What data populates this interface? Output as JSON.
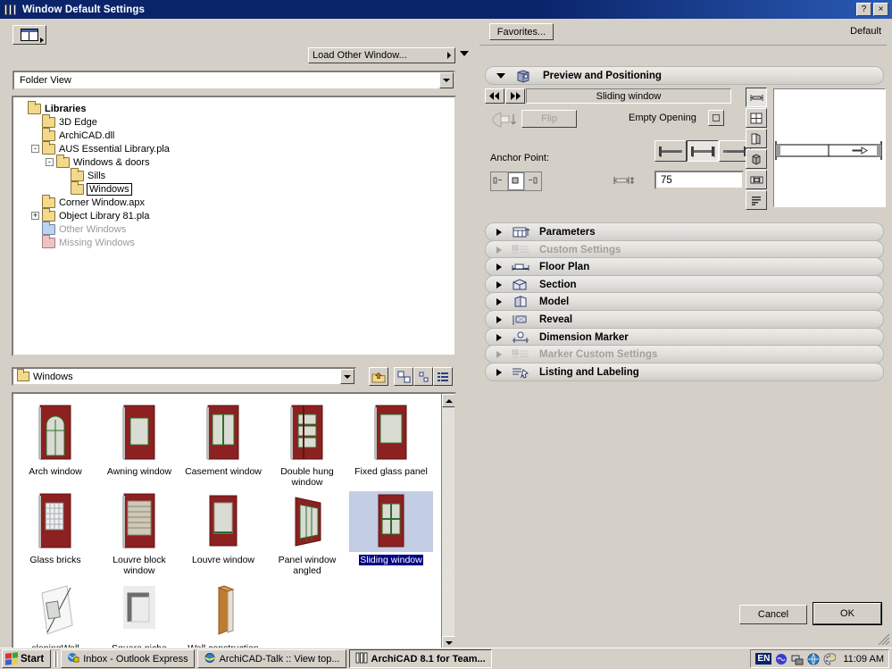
{
  "window": {
    "title": "Window Default Settings",
    "help_button": "?",
    "close_button": "×"
  },
  "left_panel": {
    "view_mode_button_icon": "window-layout-icon",
    "load_other_button": "Load Other Window...",
    "folder_view_combo": "Folder View",
    "tree": [
      {
        "label": "Libraries",
        "depth": 0,
        "bold": true,
        "expander": "",
        "folder": "yellow",
        "dim": false,
        "selected": false
      },
      {
        "label": "3D Edge",
        "depth": 1,
        "bold": false,
        "expander": "",
        "folder": "yellow",
        "dim": false,
        "selected": false
      },
      {
        "label": "ArchiCAD.dll",
        "depth": 1,
        "bold": false,
        "expander": "",
        "folder": "yellow",
        "dim": false,
        "selected": false
      },
      {
        "label": "AUS Essential Library.pla",
        "depth": 1,
        "bold": false,
        "expander": "-",
        "folder": "yellow",
        "dim": false,
        "selected": false
      },
      {
        "label": "Windows & doors",
        "depth": 2,
        "bold": false,
        "expander": "-",
        "folder": "yellow",
        "dim": false,
        "selected": false
      },
      {
        "label": "Sills",
        "depth": 3,
        "bold": false,
        "expander": "",
        "folder": "yellow",
        "dim": false,
        "selected": false
      },
      {
        "label": "Windows",
        "depth": 3,
        "bold": false,
        "expander": "",
        "folder": "yellow",
        "dim": false,
        "selected": true
      },
      {
        "label": "Corner Window.apx",
        "depth": 1,
        "bold": false,
        "expander": "",
        "folder": "yellow",
        "dim": false,
        "selected": false
      },
      {
        "label": "Object Library 81.pla",
        "depth": 1,
        "bold": false,
        "expander": "+",
        "folder": "yellow",
        "dim": false,
        "selected": false
      },
      {
        "label": "Other Windows",
        "depth": 1,
        "bold": false,
        "expander": "",
        "folder": "blue",
        "dim": true,
        "selected": false
      },
      {
        "label": "Missing Windows",
        "depth": 1,
        "bold": false,
        "expander": "",
        "folder": "pink",
        "dim": true,
        "selected": false
      }
    ],
    "folder_combo": "Windows",
    "up_button_icon": "folder-up-icon",
    "view_buttons": [
      "large-icons-view-icon",
      "small-icons-view-icon",
      "list-view-icon"
    ],
    "items": [
      [
        {
          "label": "Arch window",
          "type": "arch",
          "selected": false
        },
        {
          "label": "Awning window",
          "type": "awning",
          "selected": false
        },
        {
          "label": "Casement window",
          "type": "casement",
          "selected": false
        },
        {
          "label": "Double hung window",
          "type": "hung",
          "selected": false
        },
        {
          "label": "Fixed glass panel",
          "type": "fixed",
          "selected": false
        }
      ],
      [
        {
          "label": "Glass bricks",
          "type": "bricks",
          "selected": false
        },
        {
          "label": "Louvre block window",
          "type": "louvreblk",
          "selected": false
        },
        {
          "label": "Louvre window",
          "type": "louvre",
          "selected": false
        },
        {
          "label": "Panel window angled",
          "type": "angled",
          "selected": false
        },
        {
          "label": "Sliding window",
          "type": "sliding",
          "selected": true
        }
      ],
      [
        {
          "label": "slopingWall",
          "type": "sloping",
          "selected": false
        },
        {
          "label": "Square niche",
          "type": "niche",
          "selected": false
        },
        {
          "label": "Wall construction joint",
          "type": "joint",
          "selected": false
        }
      ]
    ]
  },
  "right_panel": {
    "favorites_button": "Favorites...",
    "default_label": "Default",
    "preview_section": {
      "title": "Preview and Positioning",
      "icon": "preview-cube-icon",
      "expanded": true,
      "prev_button_icon": "prev-arrows-icon",
      "next_button_icon": "next-arrows-icon",
      "object_name": "Sliding window",
      "flip_button": "Flip",
      "mirror_icon": "mirror-icon",
      "empty_opening_label": "Empty Opening",
      "empty_opening_checked": false,
      "anchor_point_label": "Anchor Point:",
      "sill_height_value": "75",
      "sill_height_icon": "sill-height-icon",
      "align_buttons": [
        "align-left-icon",
        "align-center-icon",
        "align-right-icon"
      ],
      "align_selected_index": 1,
      "view_tools": [
        "floor-plan-view-icon",
        "front-view-icon",
        "side-view-icon",
        "3d-view-icon",
        "section-view-icon",
        "list-view-icon"
      ],
      "view_tool_selected_index": 0
    },
    "sections": [
      {
        "label": "Parameters",
        "icon": "parameters-icon",
        "disabled": false
      },
      {
        "label": "Custom Settings",
        "icon": "custom-settings-icon",
        "disabled": true
      },
      {
        "label": "Floor Plan",
        "icon": "floor-plan-icon",
        "disabled": false
      },
      {
        "label": "Section",
        "icon": "section-icon",
        "disabled": false
      },
      {
        "label": "Model",
        "icon": "model-icon",
        "disabled": false
      },
      {
        "label": "Reveal",
        "icon": "reveal-icon",
        "disabled": false
      },
      {
        "label": "Dimension Marker",
        "icon": "dimension-marker-icon",
        "disabled": false
      },
      {
        "label": "Marker Custom Settings",
        "icon": "marker-custom-icon",
        "disabled": true
      },
      {
        "label": "Listing and Labeling",
        "icon": "listing-labeling-icon",
        "disabled": false
      }
    ],
    "cancel_button": "Cancel",
    "ok_button": "OK"
  },
  "taskbar": {
    "start_label": "Start",
    "buttons": [
      {
        "label": "Inbox - Outlook Express",
        "icon": "outlook-icon",
        "active": false
      },
      {
        "label": "ArchiCAD-Talk :: View top...",
        "icon": "ie-icon",
        "active": false
      },
      {
        "label": "ArchiCAD 8.1 for Team...",
        "icon": "archicad-icon",
        "active": true
      }
    ],
    "tray": {
      "language": "EN",
      "icons": [
        "volume-icon",
        "network-icon",
        "globe-icon",
        "palette-icon"
      ],
      "clock": "11:09 AM"
    }
  },
  "colors": {
    "titlebar": "#0a246a",
    "face": "#d4d0c8",
    "selection": "#000080",
    "window_frame_red": "#8d2020",
    "glass": "#d9dcd3"
  }
}
